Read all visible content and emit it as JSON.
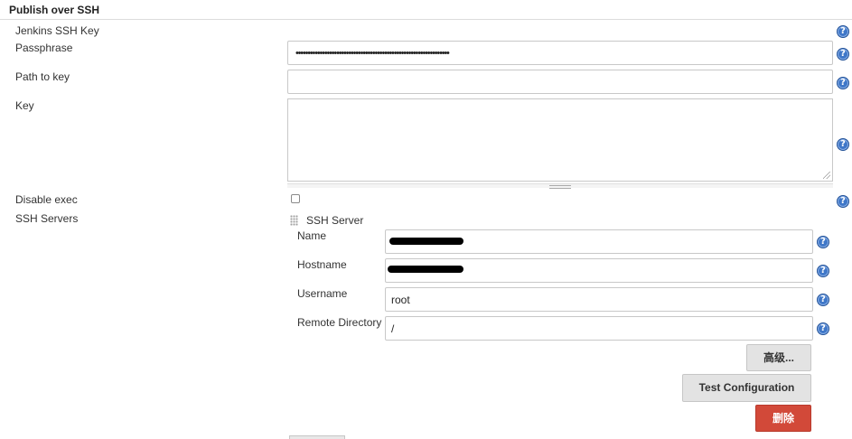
{
  "section": {
    "title": "Publish over SSH"
  },
  "fields": {
    "jenkins_ssh_key_label": "Jenkins SSH Key",
    "passphrase_label": "Passphrase",
    "passphrase_value": "••••••••••••••••••••••••••••••••••••••••••••••••••••••••••••••••",
    "path_to_key_label": "Path to key",
    "path_to_key_value": "",
    "key_label": "Key",
    "key_value": "",
    "disable_exec_label": "Disable exec",
    "disable_exec_checked": false,
    "ssh_servers_label": "SSH Servers"
  },
  "ssh_server": {
    "title": "SSH Server",
    "name_label": "Name",
    "name_value": "",
    "hostname_label": "Hostname",
    "hostname_value": "",
    "username_label": "Username",
    "username_value": "root",
    "remote_directory_label": "Remote Directory",
    "remote_directory_value": "/"
  },
  "buttons": {
    "advanced": "高级...",
    "test_configuration": "Test Configuration",
    "delete": "删除"
  },
  "help": {
    "glyph": "?"
  },
  "colors": {
    "help_icon": "#3f77c8",
    "delete_button": "#d24939",
    "button_gray": "#e3e3e3",
    "field_border": "#c8c8c8"
  },
  "icons": [
    "help-icon",
    "drag-handle-icon",
    "resize-grip-icon"
  ]
}
